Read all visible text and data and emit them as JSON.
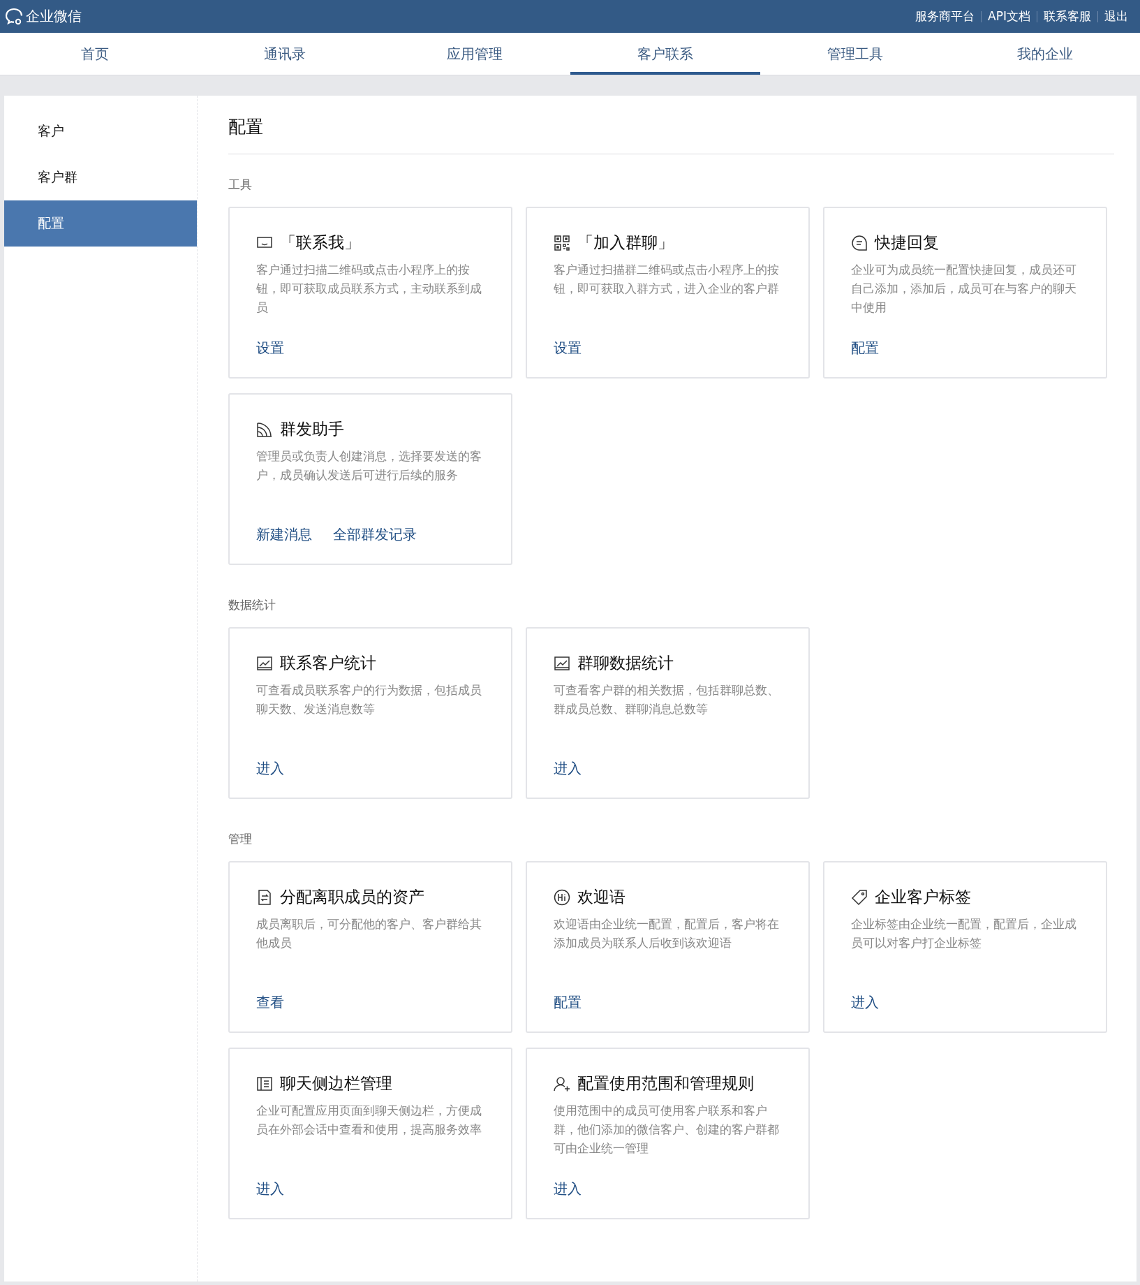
{
  "header": {
    "logo_text": "企业微信",
    "links": [
      "服务商平台",
      "API文档",
      "联系客服",
      "退出"
    ]
  },
  "nav": [
    {
      "label": "首页",
      "selected": false
    },
    {
      "label": "通讯录",
      "selected": false
    },
    {
      "label": "应用管理",
      "selected": false
    },
    {
      "label": "客户联系",
      "selected": true
    },
    {
      "label": "管理工具",
      "selected": false
    },
    {
      "label": "我的企业",
      "selected": false
    }
  ],
  "sidebar": {
    "items": [
      {
        "label": "客户",
        "selected": false
      },
      {
        "label": "客户群",
        "selected": false
      },
      {
        "label": "配置",
        "selected": true
      }
    ]
  },
  "page_title": "配置",
  "sections": [
    {
      "title": "工具",
      "cards": [
        {
          "title": "「联系我」",
          "description": "客户通过扫描二维码或点击小程序上的按钮，即可获取成员联系方式，主动联系到成员",
          "links": [
            "设置"
          ]
        },
        {
          "title": "「加入群聊」",
          "description": "客户通过扫描群二维码或点击小程序上的按钮，即可获取入群方式，进入企业的客户群",
          "links": [
            "设置"
          ]
        },
        {
          "title": "快捷回复",
          "description": "企业可为成员统一配置快捷回复，成员还可自己添加，添加后，成员可在与客户的聊天中使用",
          "links": [
            "配置"
          ]
        },
        {
          "title": "群发助手",
          "description": "管理员或负责人创建消息，选择要发送的客户，成员确认发送后可进行后续的服务",
          "links": [
            "新建消息",
            "全部群发记录"
          ]
        }
      ]
    },
    {
      "title": "数据统计",
      "cards": [
        {
          "title": "联系客户统计",
          "description": "可查看成员联系客户的行为数据，包括成员聊天数、发送消息数等",
          "links": [
            "进入"
          ]
        },
        {
          "title": "群聊数据统计",
          "description": "可查看客户群的相关数据，包括群聊总数、群成员总数、群聊消息总数等",
          "links": [
            "进入"
          ]
        }
      ]
    },
    {
      "title": "管理",
      "cards": [
        {
          "title": "分配离职成员的资产",
          "description": "成员离职后，可分配他的客户、客户群给其他成员",
          "links": [
            "查看"
          ]
        },
        {
          "title": "欢迎语",
          "description": "欢迎语由企业统一配置，配置后，客户将在添加成员为联系人后收到该欢迎语",
          "links": [
            "配置"
          ]
        },
        {
          "title": "企业客户标签",
          "description": "企业标签由企业统一配置，配置后，企业成员可以对客户打企业标签",
          "links": [
            "进入"
          ]
        },
        {
          "title": "聊天侧边栏管理",
          "description": "企业可配置应用页面到聊天侧边栏，方便成员在外部会话中查看和使用，提高服务效率",
          "links": [
            "进入"
          ]
        },
        {
          "title": "配置使用范围和管理规则",
          "description": "使用范围中的成员可使用客户联系和客户群，他们添加的微信客户、创建的客户群都可由企业统一管理",
          "links": [
            "进入"
          ]
        }
      ]
    }
  ]
}
